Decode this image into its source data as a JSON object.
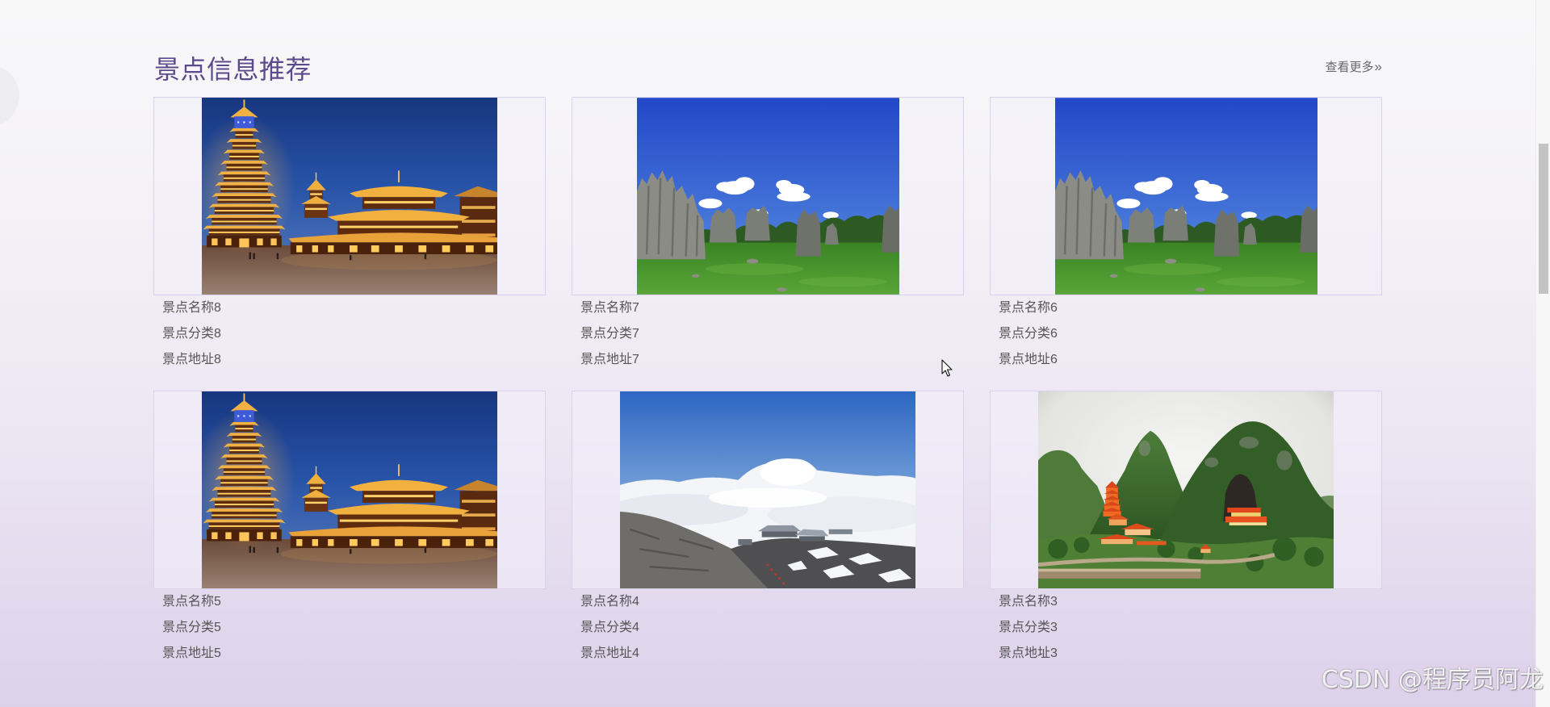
{
  "section": {
    "title": "景点信息推荐",
    "more_label": "查看更多",
    "more_icon": {
      "name": "double-chevron-right-icon",
      "glyph": "»"
    }
  },
  "items": [
    {
      "name": "景点名称8",
      "category": "景点分类8",
      "address": "景点地址8",
      "image": "drum-tower-photo"
    },
    {
      "name": "景点名称7",
      "category": "景点分类7",
      "address": "景点地址7",
      "image": "stone-forest-photo"
    },
    {
      "name": "景点名称6",
      "category": "景点分类6",
      "address": "景点地址6",
      "image": "stone-forest-photo"
    },
    {
      "name": "景点名称5",
      "category": "景点分类5",
      "address": "景点地址5",
      "image": "drum-tower-photo"
    },
    {
      "name": "景点名称4",
      "category": "景点分类4",
      "address": "景点地址4",
      "image": "sea-of-clouds-photo"
    },
    {
      "name": "景点名称3",
      "category": "景点分类3",
      "address": "景点地址3",
      "image": "karst-temple-photo"
    }
  ],
  "watermark": "CSDN @程序员阿龙",
  "colors": {
    "title": "#5b4a8c",
    "body_text": "#555555",
    "link_text": "#666666",
    "card_border": "#d9d2ec"
  }
}
